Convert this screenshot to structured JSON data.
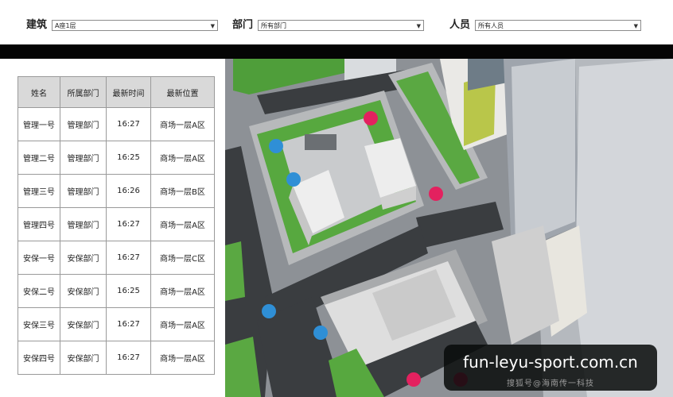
{
  "filters": {
    "building_label": "建筑",
    "building_value": "A座1层",
    "department_label": "部门",
    "department_value": "所有部门",
    "personnel_label": "人员",
    "personnel_value": "所有人员"
  },
  "table": {
    "headers": [
      "姓名",
      "所属部门",
      "最新时间",
      "最新位置"
    ],
    "rows": [
      {
        "name": "管理一号",
        "dept": "管理部门",
        "time": "16:27",
        "location": "商场一层A区"
      },
      {
        "name": "管理二号",
        "dept": "管理部门",
        "time": "16:25",
        "location": "商场一层A区"
      },
      {
        "name": "管理三号",
        "dept": "管理部门",
        "time": "16:26",
        "location": "商场一层B区"
      },
      {
        "name": "管理四号",
        "dept": "管理部门",
        "time": "16:27",
        "location": "商场一层A区"
      },
      {
        "name": "安保一号",
        "dept": "安保部门",
        "time": "16:27",
        "location": "商场一层C区"
      },
      {
        "name": "安保二号",
        "dept": "安保部门",
        "time": "16:25",
        "location": "商场一层A区"
      },
      {
        "name": "安保三号",
        "dept": "安保部门",
        "time": "16:27",
        "location": "商场一层A区"
      },
      {
        "name": "安保四号",
        "dept": "安保部门",
        "time": "16:27",
        "location": "商场一层A区"
      }
    ]
  },
  "map": {
    "marker_colors": {
      "security": "#2f8fd6",
      "management": "#e3215f"
    }
  },
  "watermark": {
    "text": "fun-leyu-sport.com.cn",
    "subtext": "搜狐号@海南传一科技"
  },
  "icons": {
    "dropdown": "caret-down-icon"
  }
}
